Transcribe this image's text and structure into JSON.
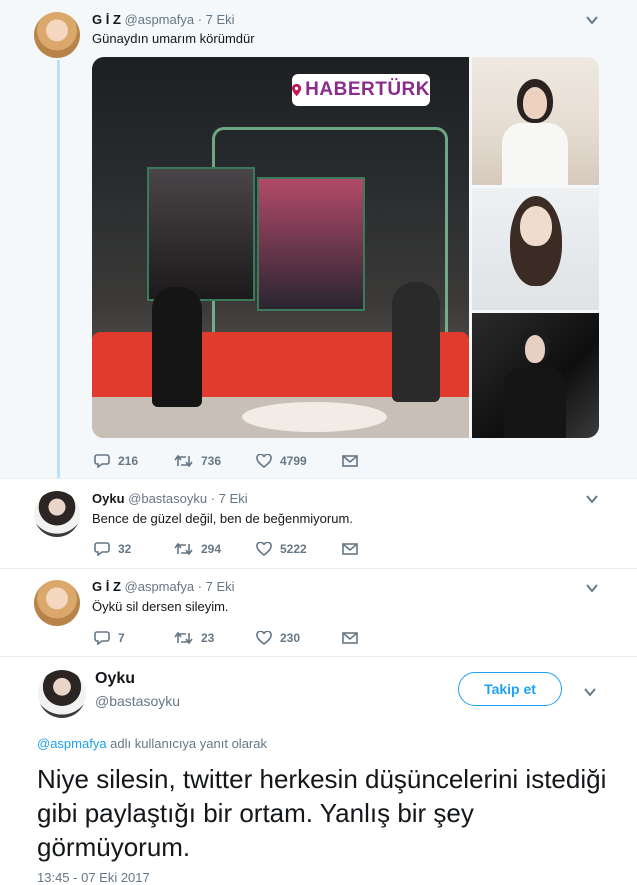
{
  "tweets": [
    {
      "name": "G İ Z",
      "handle": "@aspmafya",
      "time": "· 7 Eki",
      "text": "Günaydın umarım körümdür",
      "media_badge": "HABERTÜRK",
      "replies": "216",
      "retweets": "736",
      "likes": "4799"
    },
    {
      "name": "Oyku",
      "handle": "@bastasoyku",
      "time": "· 7 Eki",
      "text": "Bence de güzel değil, ben de beğenmiyorum.",
      "replies": "32",
      "retweets": "294",
      "likes": "5222"
    },
    {
      "name": "G İ Z",
      "handle": "@aspmafya",
      "time": "· 7 Eki",
      "text": "Öykü sil dersen sileyim.",
      "replies": "7",
      "retweets": "23",
      "likes": "230"
    }
  ],
  "main_tweet": {
    "name": "Oyku",
    "handle": "@bastasoyku",
    "follow_label": "Takip et",
    "reply_mention": "@aspmafya",
    "reply_suffix": " adlı kullanıcıya yanıt olarak",
    "text": "Niye silesin, twitter herkesin düşüncelerini istediği gibi paylaştığı bir ortam. Yanlış bir şey görmüyorum.",
    "date": "13:45 - 07 Eki 2017"
  },
  "icons": {
    "reply": "reply-icon",
    "retweet": "retweet-icon",
    "like": "heart-icon",
    "dm": "envelope-icon",
    "menu": "chevron-down-icon",
    "location": "location-pin-icon"
  },
  "colors": {
    "accent": "#1da1f2",
    "thread_line": "#b8e3f7",
    "muted": "#657786",
    "badge_text": "#8a2c8a"
  }
}
